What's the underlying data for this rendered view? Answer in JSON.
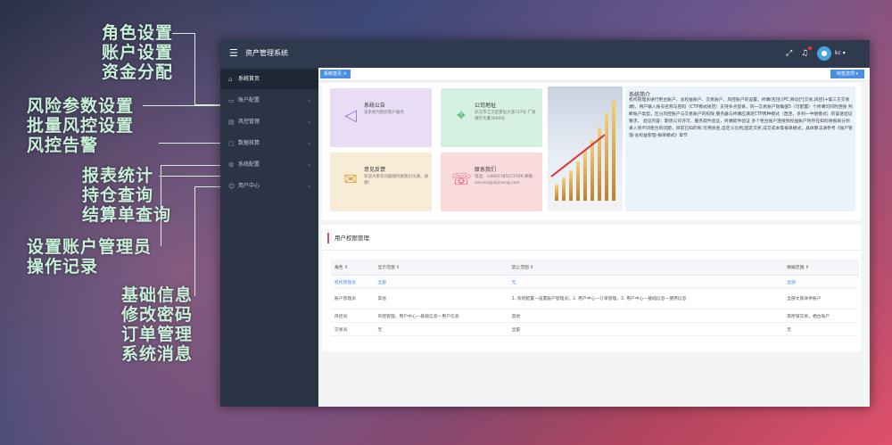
{
  "callouts": {
    "group1": [
      "角色设置",
      "账户设置",
      "资金分配"
    ],
    "group2": [
      "风险参数设置",
      "批量风控设置",
      "风控告警"
    ],
    "group3": [
      "报表统计",
      "持仓查询",
      "结算单查询"
    ],
    "group4": [
      "设置账户管理员",
      "操作记录"
    ],
    "group5": [
      "基础信息",
      "修改密码",
      "订单管理",
      "系统消息"
    ]
  },
  "app": {
    "title": "资产管理系统",
    "user": "kc",
    "icons": {
      "menu": "hamburger-icon",
      "fullscreen": "expand-icon",
      "notification": "bell-icon"
    }
  },
  "sidebar": {
    "items": [
      {
        "label": "系统首页"
      },
      {
        "label": "账户配置"
      },
      {
        "label": "风控管理"
      },
      {
        "label": "数据核算"
      },
      {
        "label": "系统配置"
      },
      {
        "label": "用户中心"
      }
    ]
  },
  "tabs": {
    "active": "系统首页",
    "options_button": "标签选项"
  },
  "cards": {
    "announcement": {
      "title": "系统公告",
      "text": "该系统为期货客户服务"
    },
    "address": {
      "title": "公司地址",
      "text": "武汉市江汉区建设大道737号 广发银行大厦3008号"
    },
    "feedback": {
      "title": "意见反馈",
      "text": "欢迎大家有问题随时跟我们沟通，谢谢！"
    },
    "contact": {
      "title": "联系我们",
      "text": "电话：+8602785573769 邮箱：service@sijinrong.com"
    }
  },
  "intro": {
    "title": "系统简介",
    "text": "机构管理员进行柜台账户、总权益账户、交易账户、风控账户的设置。终端(包括:[PC,移动]*[交易,风控]+第三方交易端)，用户输入账号名称与密码（CTP模式规范）支持多点登录，同一交易账户放确值5（可配置）个终端可同时连接 判断账户类型，区分风控账户与交易账户的权限 服务器与终端应满足CTP两种模式（直连，多到一中继模式）的穿透验证要求。 验证内容：期货公司许可，服务软件验证，终端软件验证 多个柜台账户连接到权益账户时存在如何将报单分到录入到不同柜台的问题，目前已知的有:可用资金,自定义比例,固定次序,成交成本等报单模式，具体算法请参考《账户管理-总权益管理-报单模式》章节"
  },
  "permissions": {
    "title": "用户权限管理",
    "headers": [
      "角色 ⇕",
      "显示范围 ⇕",
      "禁止范围 ⇕",
      "数据范围 ⇕"
    ],
    "rows": [
      [
        "机构管理员",
        "全部",
        "无",
        "全部"
      ],
      [
        "账户管理员",
        "其他",
        "1. 系统配置—设置账户管理员，2. 用户中心—订单管理，3. 用户中心—基础信息—使用信息",
        "全部文家体供账户"
      ],
      [
        "风控员",
        "风控管理，用户中心—基础信息—用户信息",
        "其他",
        "其所辖交易，相台账户"
      ],
      [
        "交易员",
        "无",
        "全部",
        "无"
      ]
    ]
  }
}
